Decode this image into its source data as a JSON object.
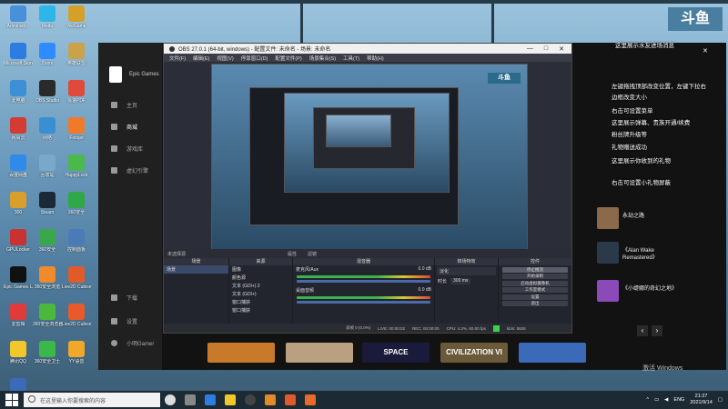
{
  "desktop": {
    "icons": [
      {
        "label": "Administr...",
        "color": "#4a90d9"
      },
      {
        "label": "Meitu",
        "color": "#2fb6e8"
      },
      {
        "label": "WeGame",
        "color": "#d4a02a"
      },
      {
        "label": "Microsoft Store",
        "color": "#2d7de0"
      },
      {
        "label": "Zoom",
        "color": "#2d8cff"
      },
      {
        "label": "英雄联盟",
        "color": "#c9a24a"
      },
      {
        "label": "此电脑",
        "color": "#3d8fd6"
      },
      {
        "label": "OBS Studio",
        "color": "#2a2a2a"
      },
      {
        "label": "极速PDF",
        "color": "#e04a3a"
      },
      {
        "label": "网易云",
        "color": "#d43c33"
      },
      {
        "label": "网络",
        "color": "#3a8fd2"
      },
      {
        "label": "Fotojet",
        "color": "#f07a2a"
      },
      {
        "label": "百度网盘",
        "color": "#2f8ae8"
      },
      {
        "label": "回收站",
        "color": "#7aa8c8"
      },
      {
        "label": "HappyLock",
        "color": "#4ab84a"
      },
      {
        "label": "300",
        "color": "#d8a02a"
      },
      {
        "label": "Steam",
        "color": "#1b2838"
      },
      {
        "label": "360安全",
        "color": "#2fa84a"
      },
      {
        "label": "GPULocker",
        "color": "#c83232"
      },
      {
        "label": "360安全",
        "color": "#3aa84a"
      },
      {
        "label": "控制面板",
        "color": "#4a7ab8"
      },
      {
        "label": "Epic Games Launcher",
        "color": "#111111"
      },
      {
        "label": "360安全浏览",
        "color": "#f08a2a"
      },
      {
        "label": "Live2D Cubism",
        "color": "#e05a2a"
      },
      {
        "label": "爱剪辑",
        "color": "#e03a3a"
      },
      {
        "label": "360安全浏览器",
        "color": "#4ab83a"
      },
      {
        "label": "Live2D Cubism",
        "color": "#e85a2a"
      },
      {
        "label": "腾讯QQ",
        "color": "#f0c82a"
      },
      {
        "label": "360安全卫士",
        "color": "#3ab84a"
      },
      {
        "label": "YY语音",
        "color": "#f0a82a"
      },
      {
        "label": "雷电模拟器 Mahjong...",
        "color": "#3a6ab8"
      }
    ]
  },
  "epic": {
    "title": "Epic Games",
    "nav": [
      "主页",
      "商城",
      "游戏库",
      "虚幻引擎"
    ],
    "bottom_nav": [
      "下载",
      "设置",
      "小明Gamer"
    ]
  },
  "obs": {
    "title": "OBS 27.0.1 (64-bit, windows) - 配置文件: 未命名 - 场景: 未命名",
    "menu": [
      "文件(F)",
      "编辑(E)",
      "视图(V)",
      "停靠窗口(D)",
      "配置文件(P)",
      "场景集合(S)",
      "工具(T)",
      "帮助(H)"
    ],
    "no_source": "未选择源",
    "properties": "属性",
    "filters": "滤镜",
    "docks": {
      "scenes": {
        "header": "场景",
        "items": [
          "场景"
        ]
      },
      "sources": {
        "header": "来源",
        "items": [
          "图像",
          "颜色源",
          "文本 (GDI+) 2",
          "文本 (GDI+)",
          "窗口捕获",
          "窗口捕获"
        ]
      },
      "mixer": {
        "header": "混音器",
        "channels": [
          {
            "name": "麦克风/Aux",
            "db": "0.0 dB"
          },
          {
            "name": "桌面音频",
            "db": "0.0 dB"
          }
        ]
      },
      "transitions": {
        "header": "转场特效",
        "mode": "淡化",
        "duration_label": "时长",
        "duration": "300 ms"
      },
      "controls": {
        "header": "控件",
        "buttons": [
          "停止推流",
          "开始录制",
          "启动虚拟摄像机",
          "工作室模式",
          "设置",
          "退出"
        ]
      }
    },
    "status": {
      "dropped": "丢帧 0 (0.0%)",
      "live": "LIVE: 00:00:02",
      "rec": "REC: 00:00:00",
      "cpu": "CPU: 4.2%, 60.00 fps",
      "kbps": "kb/s: 5826"
    }
  },
  "stream_overlay": {
    "platform": "斗鱼",
    "chat": [
      "这里展示水友进场消息",
      "左键拖拽顶部改变位置，左键下拉右",
      "边框改变大小",
      "右击可设置菜单",
      "这里展示弹幕、贵族开通/续费",
      "粉丝牌升级等",
      "礼物赠送成功",
      "这里展示你收到的礼物",
      "右击可设置小礼物屏蔽"
    ],
    "games": [
      {
        "name": "永劫之路",
        "color": "#8a6a4a"
      },
      {
        "name": "《Alan Wake Remastered》",
        "color": "#2a3a4a"
      },
      {
        "name": "《小缇娜的奇幻之地》",
        "color": "#8a4ab8"
      }
    ],
    "watermark": "激活 Windows"
  },
  "strip": [
    {
      "label": "",
      "color": "#c87a2a"
    },
    {
      "label": "",
      "color": "#b8a080"
    },
    {
      "label": "SPACE",
      "color": "#1a1a3a"
    },
    {
      "label": "CIVILIZATION VI",
      "color": "#6a5a3a"
    },
    {
      "label": "",
      "color": "#3a6ab8"
    }
  ],
  "taskbar": {
    "search_placeholder": "在这里输入你要搜索的内容",
    "time": "21:27",
    "date": "2021/9/14",
    "lang": "ENG"
  }
}
